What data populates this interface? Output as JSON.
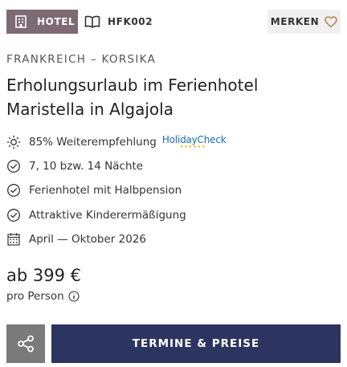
{
  "badge": {
    "label": "HOTEL",
    "icon": "hotel-building-icon",
    "color": "#7d6a72"
  },
  "code": {
    "label": "HFK002",
    "icon": "catalog-book-icon"
  },
  "merken": {
    "label": "MERKEN",
    "icon": "heart-outline-icon",
    "icon_color": "#b5834b"
  },
  "region": "FRANKREICH – KORSIKA",
  "title": "Erholungsurlaub im Ferienhotel Maristella in Algajola",
  "features": [
    {
      "icon": "sun-icon",
      "text": "85% Weiterempfehlung",
      "rating_logo": "HolidayCheck"
    },
    {
      "icon": "check-circle-icon",
      "text": "7, 10 bzw. 14 Nächte"
    },
    {
      "icon": "check-circle-icon",
      "text": "Ferienhotel mit Halbpension"
    },
    {
      "icon": "check-circle-icon",
      "text": "Attraktive Kinderermäßigung"
    },
    {
      "icon": "calendar-icon",
      "text": "April — Oktober 2026"
    }
  ],
  "price": {
    "amount": "ab 399 €",
    "per_person": "pro Person",
    "info_icon": "info-icon"
  },
  "actions": {
    "share_icon": "share-icon",
    "cta_label": "TERMINE & PREISE",
    "cta_color": "#2c3460"
  }
}
